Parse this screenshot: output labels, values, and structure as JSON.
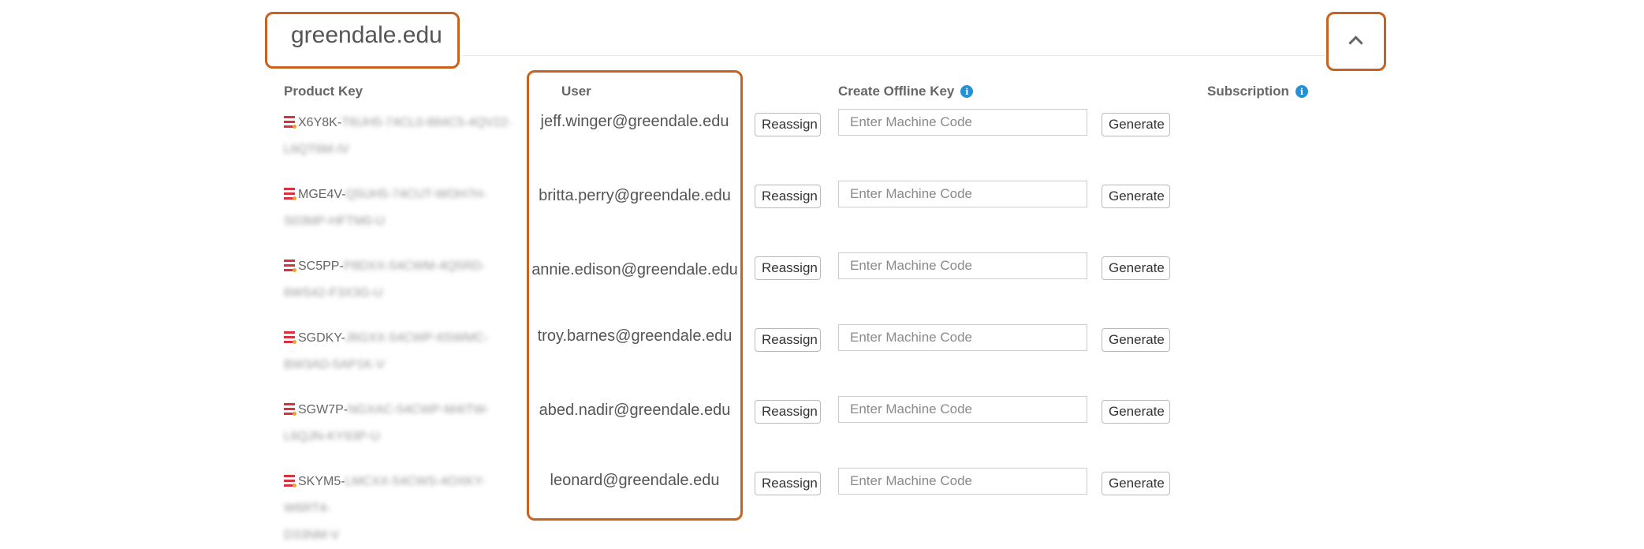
{
  "header": {
    "domain": "greendale.edu",
    "collapse_icon": "chevron-up-icon"
  },
  "columns": {
    "product_key": "Product Key",
    "user": "User",
    "offline_key": "Create Offline Key",
    "subscription": "Subscription"
  },
  "labels": {
    "reassign": "Reassign",
    "generate": "Generate",
    "machine_code_placeholder": "Enter Machine Code"
  },
  "licenses": [
    {
      "key_prefix": "X6Y8K-",
      "key_hidden": "T6UH5-74CL0-884C5-4QV22-",
      "key_hidden2": "L6QT6M-IV",
      "user": "jeff.winger@greendale.edu"
    },
    {
      "key_prefix": "MGE4V-",
      "key_hidden": "Q5UH5-74CUT-WOH7H-",
      "key_hidden2": "S03MP-HFTM0-U",
      "user": "britta.perry@greendale.edu"
    },
    {
      "key_prefix": "SC5PP-",
      "key_hidden": "P8DXX-54CWM-4Q5RD-",
      "key_hidden2": "6WS42-F3X3G-U",
      "user": "annie.edison@greendale.edu"
    },
    {
      "key_prefix": "SGDKY-",
      "key_hidden": "J6GXX-54CWP-6SWMC-",
      "key_hidden2": "BW3AD-5AP1K-V",
      "user": "troy.barnes@greendale.edu"
    },
    {
      "key_prefix": "SGW7P-",
      "key_hidden": "NGXAC-54CWP-M4ITW-",
      "key_hidden2": "L6QJN-KY93P-U",
      "user": "abed.nadir@greendale.edu"
    },
    {
      "key_prefix": "SKYM5-",
      "key_hidden": "LMCXX-54CWS-4OXKY-W6RT4-",
      "key_hidden2": "D33NM-V",
      "user": "leonard@greendale.edu"
    }
  ],
  "colors": {
    "highlight": "#c8621d",
    "info": "#2490d6",
    "key_icon": "#d63340"
  }
}
